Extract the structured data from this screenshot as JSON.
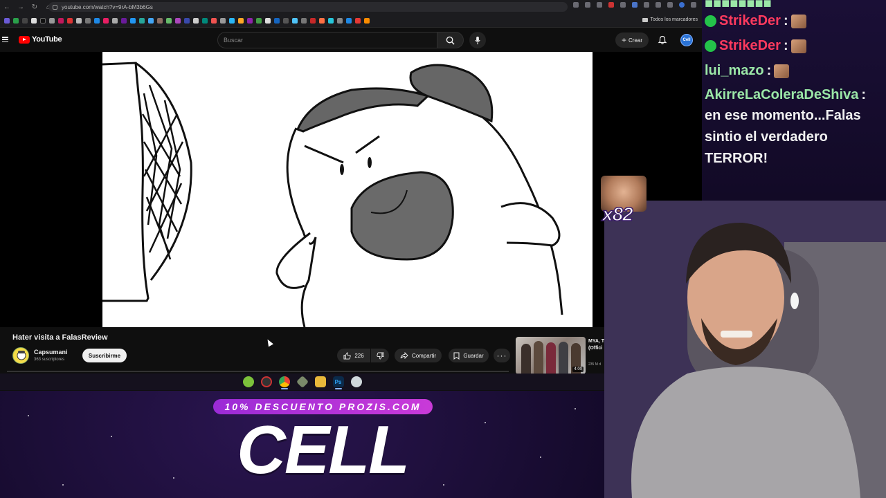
{
  "browser": {
    "url": "youtube.com/watch?v=9rA-bM3b6Gs",
    "bookmarks_folder_label": "Todos los marcadores"
  },
  "youtube": {
    "logo_text": "YouTube",
    "search_placeholder": "Buscar",
    "create_label": "Crear",
    "avatar_initials": "Cell"
  },
  "video": {
    "title": "Hater visita a FalasReview",
    "channel_name": "Capsumani",
    "channel_subscribers": "363 suscriptores",
    "subscribe_label": "Suscribirme",
    "like_count": "226",
    "share_label": "Compartir",
    "save_label": "Guardar"
  },
  "suggestion": {
    "title_line1": "MYA, T",
    "title_line2": "(Offici",
    "meta": "235 M d",
    "duration": "4:00"
  },
  "chat": {
    "messages": [
      {
        "user": "StrikeDer",
        "colon": ":",
        "badge": "cell"
      },
      {
        "user": "StrikeDer",
        "colon": ":",
        "badge": "cell"
      },
      {
        "user": "lui_mazo",
        "colon": ":"
      },
      {
        "user": "AkirreLaColeraDeShiva",
        "colon": ":"
      }
    ],
    "message_text": "en ese momento...Falas sintio el verdadero TERROR!"
  },
  "overlay": {
    "sub_multiplier": "x82",
    "promo": "10% DESCUENTO PROZIS.COM",
    "streamer_name": "CELL"
  },
  "colors": {
    "youtube_red": "#ff0000",
    "chat_user_red": "#ff3a5e",
    "chat_user_green": "#9be7a7",
    "promo_purple": "#b532d8"
  }
}
